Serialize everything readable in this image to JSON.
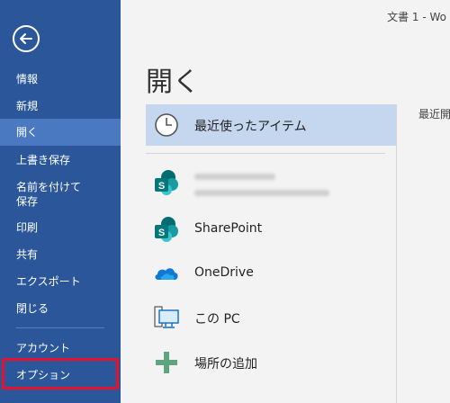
{
  "window": {
    "doc_title": "文書 1 - Wo"
  },
  "sidebar": {
    "back_icon": "back-arrow-icon",
    "items": [
      {
        "label": "情報"
      },
      {
        "label": "新規"
      },
      {
        "label": "開く"
      },
      {
        "label": "上書き保存"
      },
      {
        "label": "名前を付けて"
      },
      {
        "label": "保存"
      },
      {
        "label": "印刷"
      },
      {
        "label": "共有"
      },
      {
        "label": "エクスポート"
      },
      {
        "label": "閉じる"
      },
      {
        "label": "アカウント"
      },
      {
        "label": "オプション"
      }
    ],
    "colors": {
      "background": "#2b579a",
      "active": "#4a78c1",
      "highlight_border": "#e8112d"
    }
  },
  "main": {
    "page_title": "開く",
    "recent_label": "最近開",
    "locations": [
      {
        "label": "最近使ったアイテム",
        "icon": "clock-icon",
        "selected": true
      },
      {
        "label": "",
        "icon": "sharepoint-icon",
        "blurred": true
      },
      {
        "label": "SharePoint",
        "icon": "sharepoint-icon"
      },
      {
        "label": "OneDrive",
        "icon": "cloud-icon"
      },
      {
        "label": "この PC",
        "icon": "computer-icon"
      },
      {
        "label": "場所の追加",
        "icon": "plus-icon"
      }
    ]
  }
}
